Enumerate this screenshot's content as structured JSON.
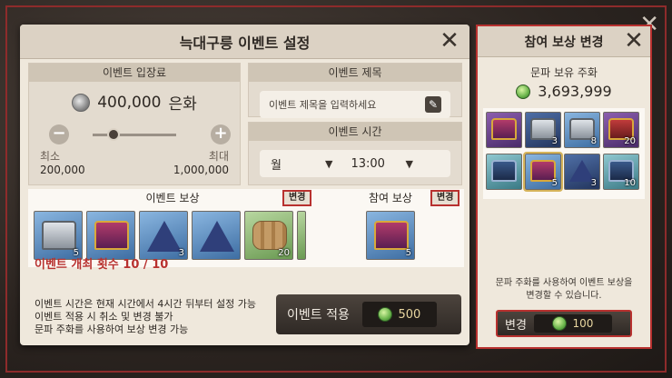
{
  "dialog": {
    "title": "늑대구릉 이벤트 설정",
    "entry_fee": {
      "header": "이벤트 입장료",
      "amount": "400,000",
      "unit": "은화",
      "min_label": "최소",
      "min_value": "200,000",
      "max_label": "최대",
      "max_value": "1,000,000",
      "level": 0.25
    },
    "event_name": {
      "header": "이벤트 제목",
      "placeholder": "이벤트 제목을 입력하세요"
    },
    "event_time": {
      "header": "이벤트 시간",
      "day": "월",
      "time": "13:00"
    },
    "event_reward": {
      "header": "이벤트 보상",
      "change_label": "변경",
      "items": [
        {
          "icon": "silver-chest-icon",
          "count": "5"
        },
        {
          "icon": "purple-chest-icon",
          "count": ""
        },
        {
          "icon": "prism-icon",
          "count": "3"
        },
        {
          "icon": "prism-icon",
          "count": ""
        },
        {
          "icon": "wood-log-icon",
          "count": "20"
        }
      ]
    },
    "participation_reward": {
      "header": "참여 보상",
      "change_label": "변경",
      "items": [
        {
          "icon": "purple-chest-icon",
          "count": "5"
        }
      ]
    },
    "count_text": "이벤트 개최 횟수 10 / 10",
    "info_lines": [
      "이벤트 시간은 현재 시간에서 4시간 뒤부터 설정 가능",
      "이벤트 적용 시 취소 및 변경 불가",
      "문파 주화를 사용하여 보상 변경 가능"
    ],
    "apply": {
      "label": "이벤트 적용",
      "cost": "500"
    }
  },
  "side": {
    "title": "참여 보상 변경",
    "holdings_label": "문파 보유 주화",
    "holdings_value": "3,693,999",
    "grid": [
      {
        "icon": "purple-chest-icon",
        "count": ""
      },
      {
        "icon": "silver-chest-icon",
        "count": "3"
      },
      {
        "icon": "silver-chest-icon",
        "count": "8"
      },
      {
        "icon": "red-chest-icon",
        "count": "20"
      },
      {
        "icon": "blue-chest-icon",
        "count": ""
      },
      {
        "icon": "purple-chest-icon",
        "count": "5"
      },
      {
        "icon": "prism-icon",
        "count": "3"
      },
      {
        "icon": "teal-chest-icon",
        "count": "10"
      }
    ],
    "note_line1": "문파 주화를 사용하여 이벤트 보상을",
    "note_line2": "변경할 수 있습니다.",
    "change_button": {
      "label": "변경",
      "cost": "100"
    }
  },
  "colors": {
    "accent_red": "#b8312f",
    "panel_bg": "#efe8dc",
    "coin_green": "#68b34a"
  }
}
